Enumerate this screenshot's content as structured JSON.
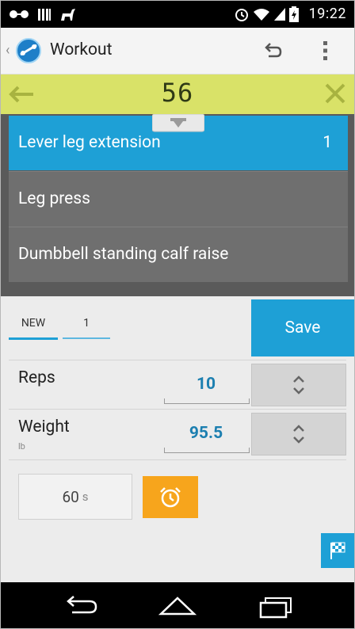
{
  "status_bar": {
    "time": "19:22"
  },
  "action_bar": {
    "title": "Workout"
  },
  "toolbar": {
    "number": "56"
  },
  "exercises": [
    {
      "label": "Lever leg extension",
      "count": "1"
    },
    {
      "label": "Leg press",
      "count": ""
    },
    {
      "label": "Dumbbell standing calf raise",
      "count": ""
    }
  ],
  "sets": {
    "tabs": [
      "NEW",
      "1"
    ],
    "save_label": "Save"
  },
  "reps": {
    "label": "Reps",
    "value": "10"
  },
  "weight": {
    "label": "Weight",
    "unit": "lb",
    "value": "95.5"
  },
  "timer": {
    "value": "60",
    "unit": "s"
  },
  "colors": {
    "accent": "#1ea0d6",
    "highlight_bar": "#d9e268",
    "alarm": "#f7a51c"
  }
}
